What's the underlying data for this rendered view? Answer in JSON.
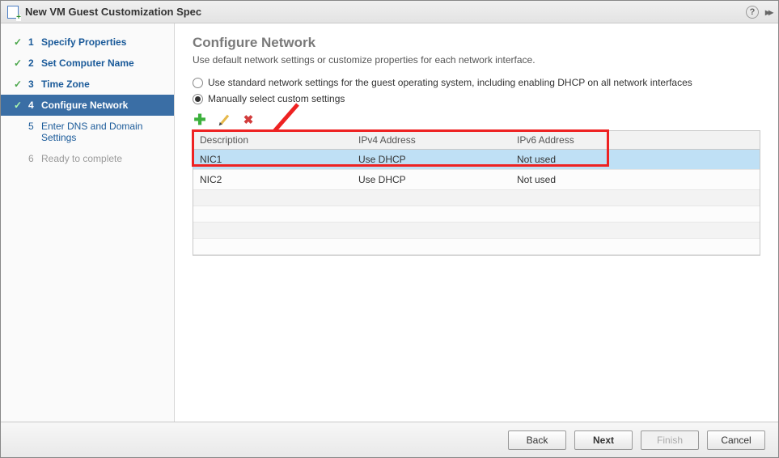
{
  "titlebar": {
    "title": "New VM Guest Customization Spec"
  },
  "sidebar": {
    "steps": [
      {
        "num": "1",
        "label": "Specify Properties"
      },
      {
        "num": "2",
        "label": "Set Computer Name"
      },
      {
        "num": "3",
        "label": "Time Zone"
      },
      {
        "num": "4",
        "label": "Configure Network"
      },
      {
        "num": "5",
        "label": "Enter DNS and Domain Settings"
      },
      {
        "num": "6",
        "label": "Ready to complete"
      }
    ]
  },
  "main": {
    "heading": "Configure Network",
    "subtitle": "Use default network settings or customize properties for each network interface.",
    "radio_standard": "Use standard network settings for the guest operating system, including enabling DHCP on all network interfaces",
    "radio_manual": "Manually select custom settings",
    "table": {
      "cols": {
        "desc": "Description",
        "ipv4": "IPv4 Address",
        "ipv6": "IPv6 Address"
      },
      "rows": [
        {
          "desc": "NIC1",
          "ipv4": "Use DHCP",
          "ipv6": "Not used"
        },
        {
          "desc": "NIC2",
          "ipv4": "Use DHCP",
          "ipv6": "Not used"
        }
      ]
    }
  },
  "footer": {
    "back": "Back",
    "next": "Next",
    "finish": "Finish",
    "cancel": "Cancel"
  }
}
